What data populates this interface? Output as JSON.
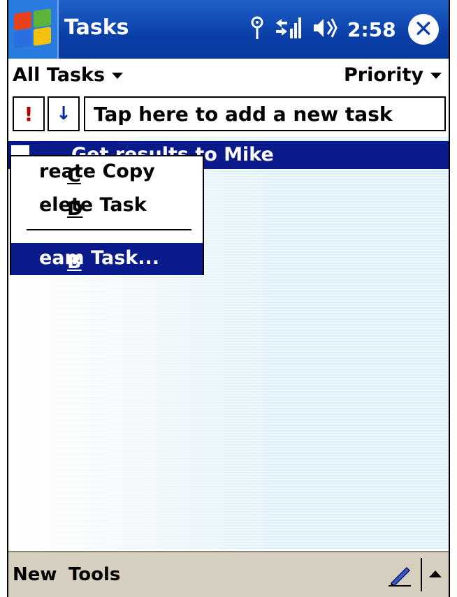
{
  "titlebar": {
    "title": "Tasks",
    "clock": "2:58",
    "icons": [
      "antenna-icon",
      "signal-icon",
      "speaker-icon",
      "close-icon"
    ],
    "colors": {
      "bar": "#0a3fa8",
      "start": "#2a7be0"
    }
  },
  "filters": {
    "category": "All Tasks",
    "sort": "Priority"
  },
  "entry": {
    "priority_symbol": "!",
    "sort_symbol": "↓",
    "placeholder": "Tap here to add a new task"
  },
  "tasks": [
    {
      "label": "Get results to Mike",
      "selected": true,
      "checked": false
    }
  ],
  "context_menu": {
    "items": [
      {
        "label": "Create Copy",
        "mnemonic": "C"
      },
      {
        "label": "Delete Task",
        "mnemonic": "D"
      },
      {
        "label": "Beam Task...",
        "mnemonic": "B",
        "highlighted": true
      }
    ]
  },
  "bottombar": {
    "new": "New",
    "tools": "Tools"
  },
  "colors": {
    "highlight": "#0a1a8a",
    "bottom": "#d6cfc0",
    "priority": "#b00000"
  }
}
